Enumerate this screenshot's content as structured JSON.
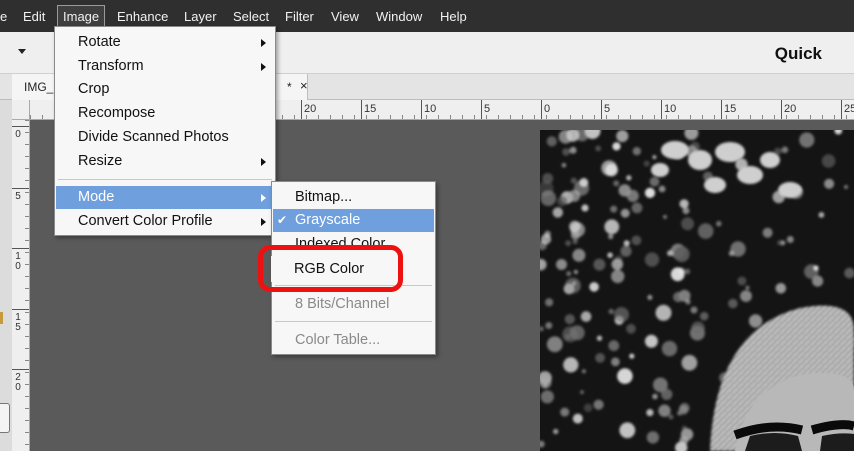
{
  "menubar": {
    "items": [
      {
        "label": "e"
      },
      {
        "label": "Edit"
      },
      {
        "label": "Image"
      },
      {
        "label": "Enhance"
      },
      {
        "label": "Layer"
      },
      {
        "label": "Select"
      },
      {
        "label": "Filter"
      },
      {
        "label": "View"
      },
      {
        "label": "Window"
      },
      {
        "label": "Help"
      }
    ]
  },
  "toolbar": {
    "mode_label": "Quick"
  },
  "document_tab": {
    "name": "IMG_",
    "modified_marker": "*",
    "close_symbol": "×"
  },
  "ruler": {
    "horizontal_labels": [
      "20",
      "15",
      "10",
      "5",
      "0",
      "5",
      "10",
      "15",
      "20",
      "25"
    ],
    "vertical_labels": [
      "0",
      "5",
      "10",
      "15",
      "20"
    ]
  },
  "image_menu": {
    "items": [
      {
        "label": "Rotate",
        "submenu": true
      },
      {
        "label": "Transform",
        "submenu": true
      },
      {
        "label": "Crop",
        "submenu": false
      },
      {
        "label": "Recompose",
        "submenu": false
      },
      {
        "label": "Divide Scanned Photos",
        "submenu": false
      },
      {
        "label": "Resize",
        "submenu": true
      },
      {
        "label": "Mode",
        "submenu": true,
        "highlighted": true
      },
      {
        "label": "Convert Color Profile",
        "submenu": true
      }
    ]
  },
  "mode_submenu": {
    "items": [
      {
        "label": "Bitmap...",
        "enabled": true
      },
      {
        "label": "Grayscale",
        "enabled": true,
        "checked": true,
        "highlighted": true
      },
      {
        "label": "Indexed Color...",
        "enabled": true
      },
      {
        "label": "RGB Color",
        "enabled": true,
        "callout": true
      },
      {
        "label": "8 Bits/Channel",
        "enabled": false
      },
      {
        "label": "Color Table...",
        "enabled": false
      }
    ],
    "check_mark": "✔"
  },
  "colors": {
    "menubar_bg": "#2f2f2f",
    "highlight": "#6f9fdc",
    "callout": "#ee1111",
    "canvas_bg": "#5a5a5a"
  }
}
